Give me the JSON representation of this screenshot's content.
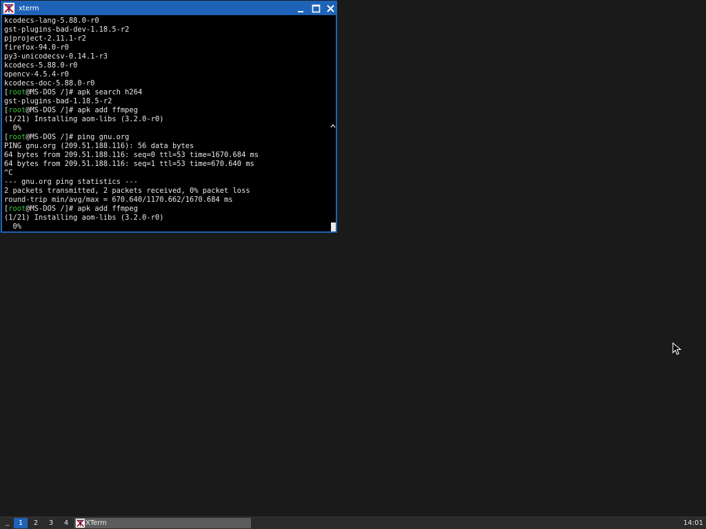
{
  "window": {
    "title": "xterm",
    "icon": "xterm-logo-icon"
  },
  "terminal": {
    "lines": [
      {
        "type": "text",
        "text": "kcodecs-lang-5.88.0-r0"
      },
      {
        "type": "text",
        "text": "gst-plugins-bad-dev-1.18.5-r2"
      },
      {
        "type": "text",
        "text": "pjproject-2.11.1-r2"
      },
      {
        "type": "text",
        "text": "firefox-94.0-r0"
      },
      {
        "type": "text",
        "text": "py3-unicodecsv-0.14.1-r3"
      },
      {
        "type": "text",
        "text": "kcodecs-5.88.0-r0"
      },
      {
        "type": "text",
        "text": "opencv-4.5.4-r0"
      },
      {
        "type": "text",
        "text": "kcodecs-doc-5.88.0-r0"
      },
      {
        "type": "prompt",
        "user": "root",
        "rest": "@MS-DOS /]# apk search h264"
      },
      {
        "type": "text",
        "text": "gst-plugins-bad-1.18.5-r2"
      },
      {
        "type": "prompt",
        "user": "root",
        "rest": "@MS-DOS /]# apk add ffmpeg"
      },
      {
        "type": "text",
        "text": "(1/21) Installing aom-libs (3.2.0-r0)"
      },
      {
        "type": "text",
        "text": "  0%"
      },
      {
        "type": "prompt",
        "user": "root",
        "rest": "@MS-DOS /]# ping gnu.org"
      },
      {
        "type": "text",
        "text": "PING gnu.org (209.51.188.116): 56 data bytes"
      },
      {
        "type": "text",
        "text": "64 bytes from 209.51.188.116: seq=0 ttl=53 time=1670.684 ms"
      },
      {
        "type": "text",
        "text": "64 bytes from 209.51.188.116: seq=1 ttl=53 time=670.640 ms"
      },
      {
        "type": "text",
        "text": "^C"
      },
      {
        "type": "text",
        "text": "--- gnu.org ping statistics ---"
      },
      {
        "type": "text",
        "text": "2 packets transmitted, 2 packets received, 0% packet loss"
      },
      {
        "type": "text",
        "text": "round-trip min/avg/max = 670.640/1170.662/1670.684 ms"
      },
      {
        "type": "prompt",
        "user": "root",
        "rest": "@MS-DOS /]# apk add ffmpeg"
      },
      {
        "type": "text",
        "text": "(1/21) Installing aom-libs (3.2.0-r0)"
      },
      {
        "type": "text",
        "text": "  0%"
      }
    ],
    "prompt_open": "[",
    "fg_color": "#e8e8e8",
    "user_color": "#37c837"
  },
  "taskbar": {
    "menu_label": "_",
    "workspaces": [
      "1",
      "2",
      "3",
      "4"
    ],
    "active_workspace": "1",
    "task_label": "XTerm",
    "clock": "14:01"
  },
  "colors": {
    "accent": "#1e63b8",
    "desktop": "#1a1a1a"
  }
}
